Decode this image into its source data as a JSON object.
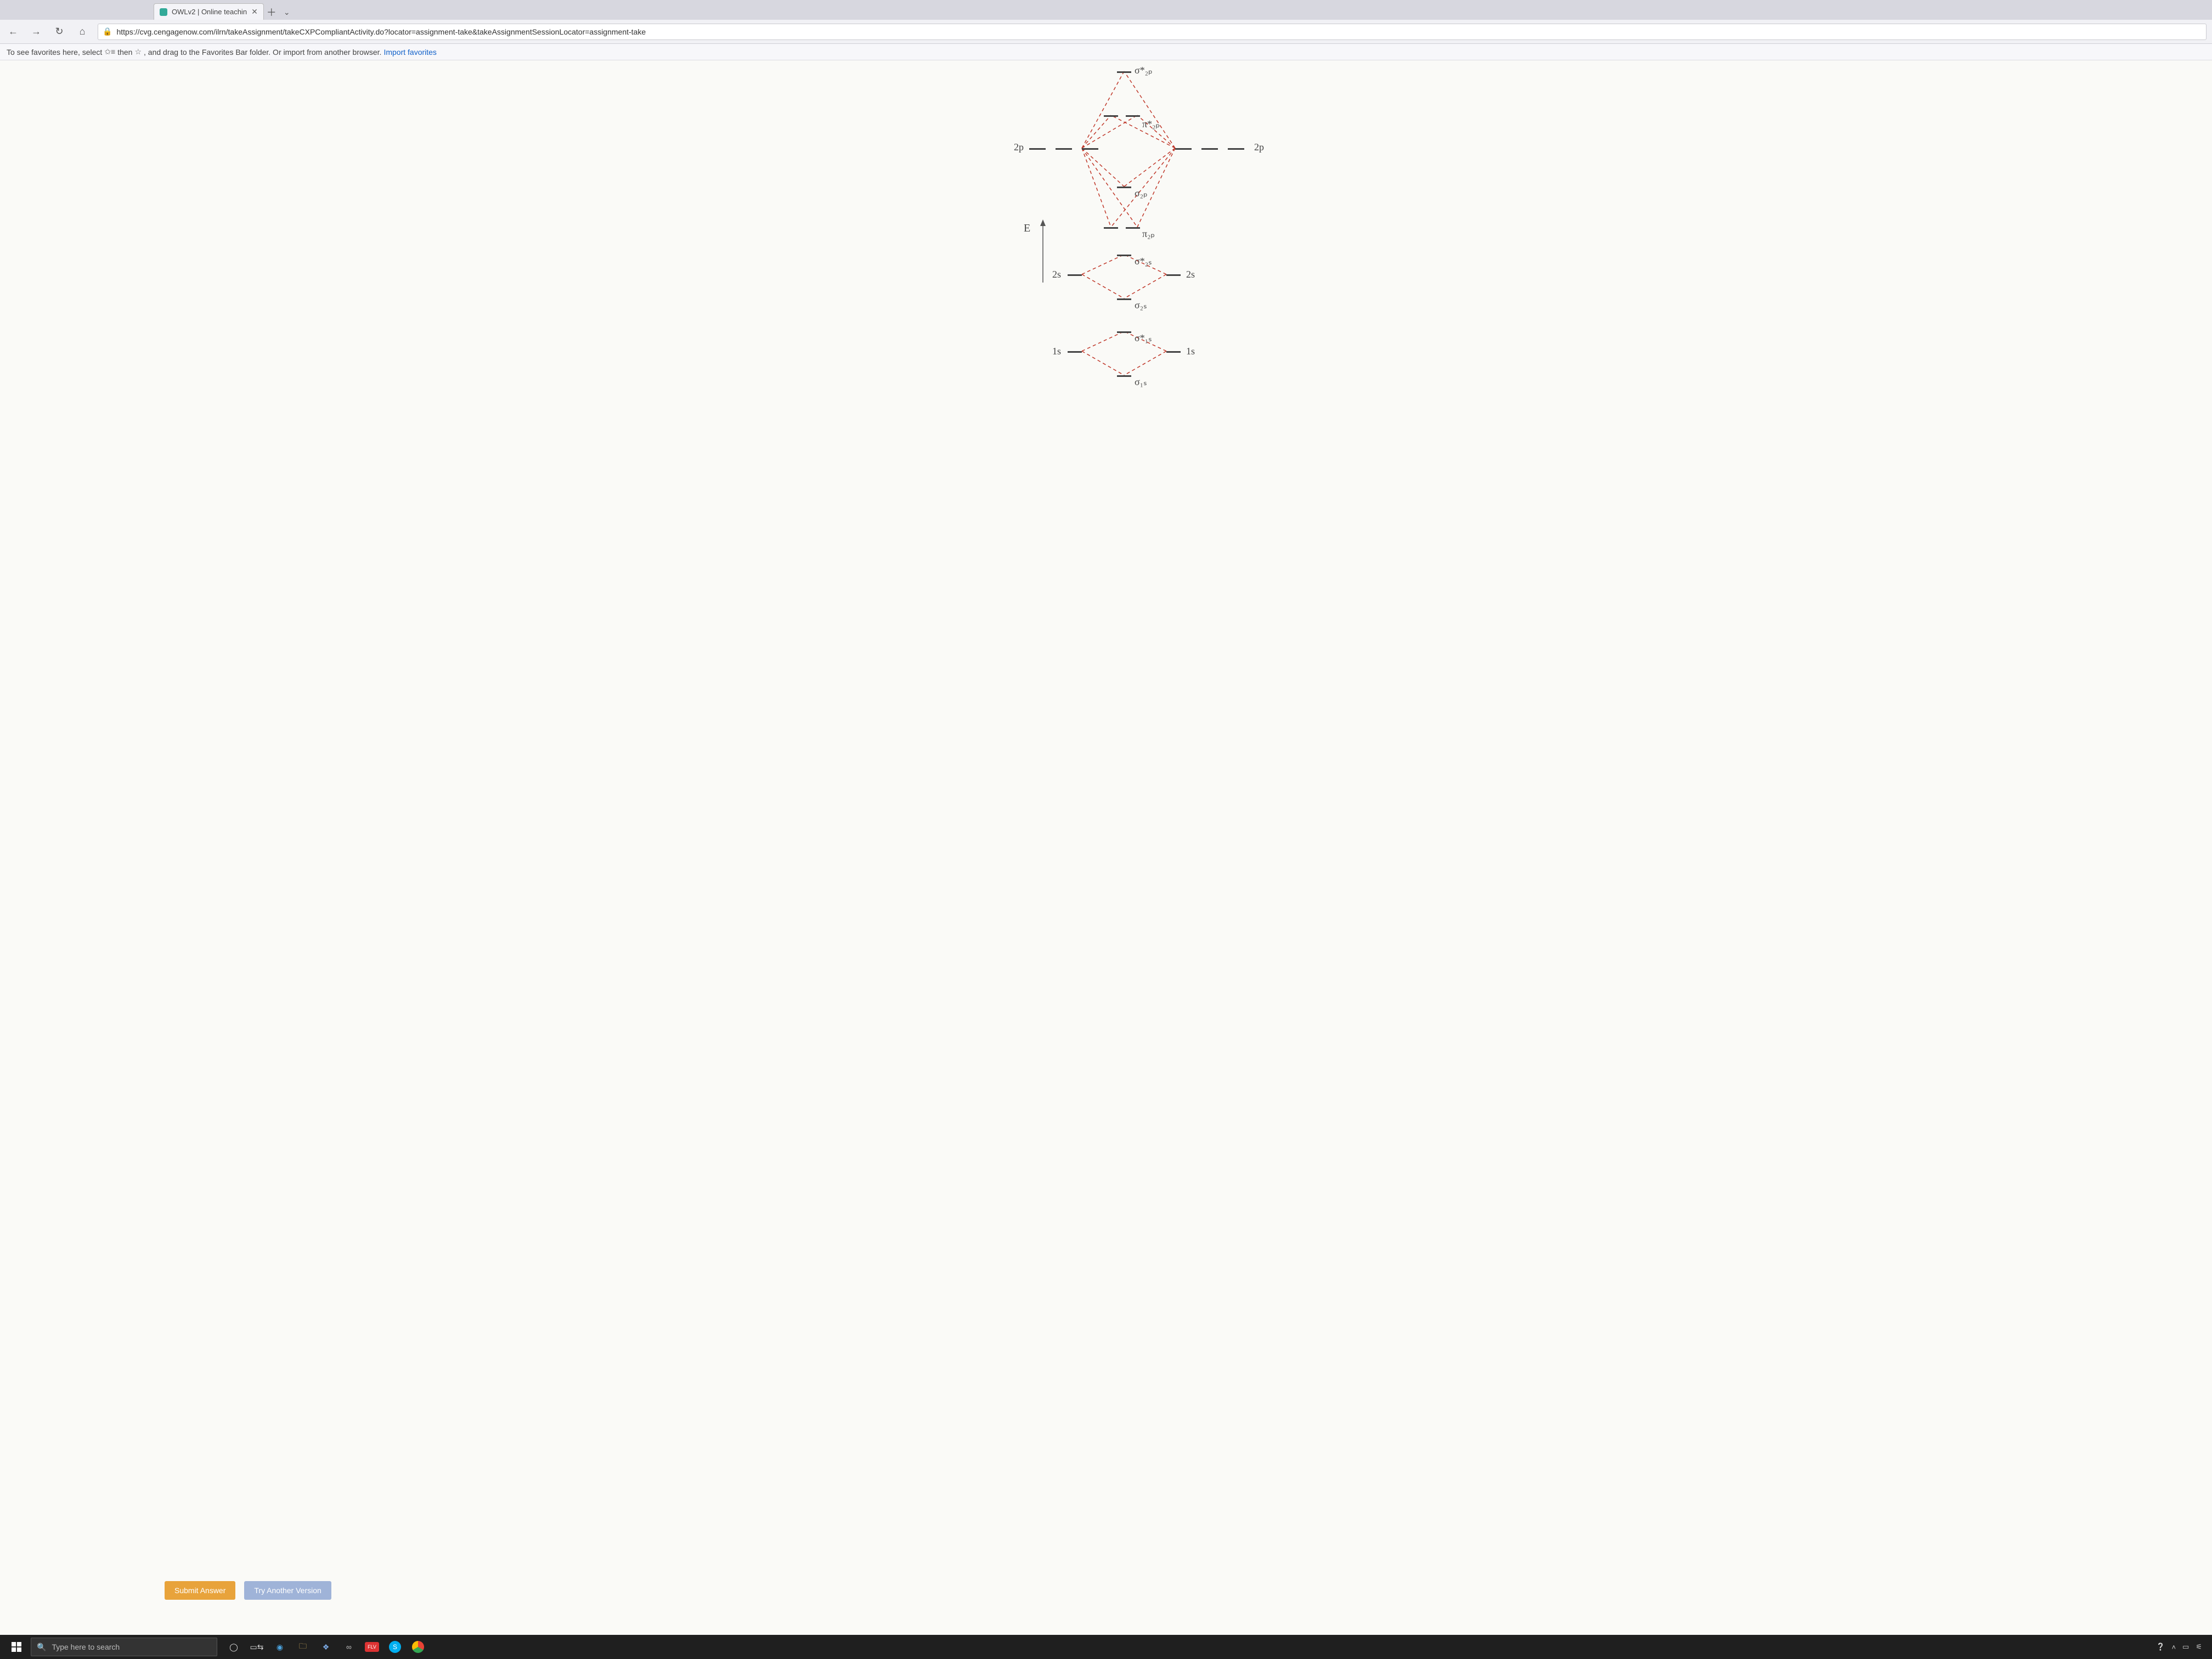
{
  "browser": {
    "tab_title": "OWLv2 | Online teachin",
    "url": "https://cvg.cengagenow.com/ilrn/takeAssignment/takeCXPCompliantActivity.do?locator=assignment-take&takeAssignmentSessionLocator=assignment-take",
    "favbar_prefix": "To see favorites here, select ",
    "favbar_mid": " then ",
    "favbar_suffix": ", and drag to the Favorites Bar folder. Or import from another browser. ",
    "favbar_link": "Import favorites"
  },
  "diagram": {
    "axis_label": "E",
    "left_2p": "2p",
    "right_2p": "2p",
    "left_2s": "2s",
    "right_2s": "2s",
    "left_1s": "1s",
    "right_1s": "1s",
    "sigma_star_2p": "σ*₂ₚ",
    "pi_star_2p": "π*₂ₚ",
    "sigma_2p": "σ₂ₚ",
    "pi_2p": "π₂ₚ",
    "sigma_star_2s": "σ*₂ₛ",
    "sigma_2s": "σ₂ₛ",
    "sigma_star_1s": "σ*₁ₛ",
    "sigma_1s": "σ₁ₛ"
  },
  "buttons": {
    "submit": "Submit Answer",
    "try": "Try Another Version"
  },
  "taskbar": {
    "search_placeholder": "Type here to search",
    "flv": "FLV"
  }
}
